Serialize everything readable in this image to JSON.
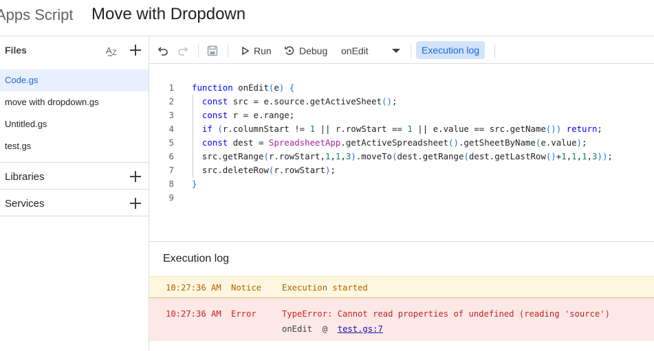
{
  "header": {
    "app_name": "Apps Script",
    "project_title": "Move with Dropdown"
  },
  "sidebar": {
    "files_label": "Files",
    "files": [
      {
        "name": "Code.gs",
        "active": true
      },
      {
        "name": "move with dropdown.gs",
        "active": false
      },
      {
        "name": "Untitled.gs",
        "active": false
      },
      {
        "name": "test.gs",
        "active": false
      }
    ],
    "libraries_label": "Libraries",
    "services_label": "Services"
  },
  "toolbar": {
    "run_label": "Run",
    "debug_label": "Debug",
    "function_select_value": "onEdit",
    "execution_log_label": "Execution log"
  },
  "editor": {
    "line_numbers": [
      "1",
      "2",
      "3",
      "4",
      "5",
      "6",
      "7",
      "8",
      "9"
    ]
  },
  "execution_log": {
    "title": "Execution log",
    "entries": [
      {
        "time": "10:27:36 AM",
        "level": "Notice",
        "message": "Execution started"
      },
      {
        "time": "10:27:36 AM",
        "level": "Error",
        "message": "TypeError: Cannot read properties of undefined (reading 'source')",
        "function": "onEdit",
        "at": "@",
        "location": "test.gs:7"
      }
    ]
  },
  "colors": {
    "accent": "#1a73e8",
    "active_file_bg": "#e8f0fe",
    "notice_bg": "#fef7e0",
    "error_bg": "#fce8e6"
  }
}
